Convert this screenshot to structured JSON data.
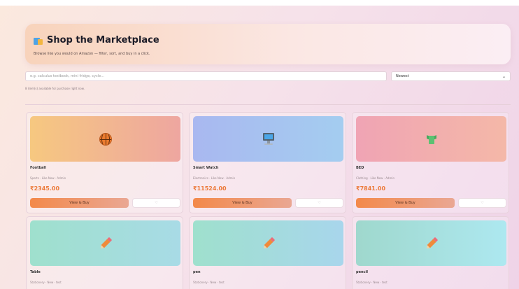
{
  "hero": {
    "title": "Shop the Marketplace",
    "subtitle": "Browse like you would on Amazon — filter, sort, and buy in a click."
  },
  "search": {
    "placeholder": "e.g. calculus textbook, mini fridge, cycle..."
  },
  "sort": {
    "selected": "Newest"
  },
  "results": {
    "count_text": "8 item(s) available for purchase right now."
  },
  "colors": {
    "accent": "#ec7a3a",
    "buy_button": "#f3894a"
  },
  "cards": [
    {
      "name": "Football",
      "meta": "Sports · Like New · Admin",
      "price": "₹2345.00",
      "buy_label": "View & Buy",
      "icon": "basketball-icon",
      "thumb_gradient": "linear-gradient(90deg,#f6c880,#eea6a0)"
    },
    {
      "name": "Smart Watch",
      "meta": "Electronics · Like New · Admin",
      "price": "₹11524.00",
      "buy_label": "View & Buy",
      "icon": "computer-icon",
      "thumb_gradient": "linear-gradient(90deg,#a9b8f0,#a4cdf0)"
    },
    {
      "name": "BED",
      "meta": "Clothing · Like New · Admin",
      "price": "₹7841.00",
      "buy_label": "View & Buy",
      "icon": "tshirt-icon",
      "thumb_gradient": "linear-gradient(90deg,#f0a4b4,#f4b8a8)"
    },
    {
      "name": "Table",
      "meta": "Stationery · New · test",
      "price": "",
      "buy_label": "",
      "icon": "pencil-icon",
      "thumb_gradient": "linear-gradient(90deg,#9fe0cd,#a8dbe6)"
    },
    {
      "name": "pen",
      "meta": "Stationery · New · test",
      "price": "",
      "buy_label": "",
      "icon": "pencil-icon",
      "thumb_gradient": "linear-gradient(90deg,#9fe0cd,#a8d6ec)"
    },
    {
      "name": "pencil",
      "meta": "Stationery · New · test",
      "price": "",
      "buy_label": "",
      "icon": "pencil-icon",
      "thumb_gradient": "linear-gradient(90deg,#9fd8cd,#ade8f0)"
    }
  ]
}
